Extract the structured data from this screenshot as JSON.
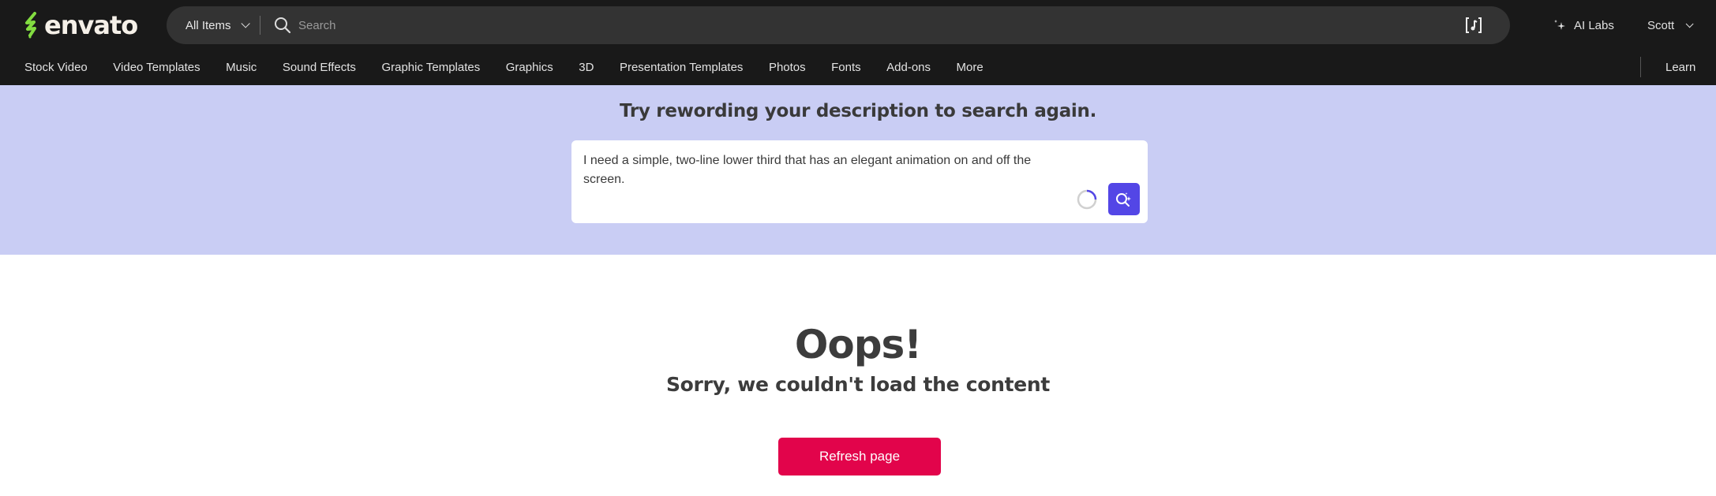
{
  "header": {
    "logo_text": "envato",
    "brand_color": "#82dc40",
    "category_select": "All Items",
    "search_placeholder": "Search",
    "ai_labs_label": "AI Labs",
    "user_name": "Scott",
    "icons": {
      "search": "search-icon",
      "audio_search": "music-note-scan-icon",
      "ai_labs": "sparkle-icon"
    }
  },
  "nav": {
    "items": [
      {
        "label": "Stock Video"
      },
      {
        "label": "Video Templates"
      },
      {
        "label": "Music"
      },
      {
        "label": "Sound Effects"
      },
      {
        "label": "Graphic Templates"
      },
      {
        "label": "Graphics"
      },
      {
        "label": "3D"
      },
      {
        "label": "Presentation Templates"
      },
      {
        "label": "Photos"
      },
      {
        "label": "Fonts"
      },
      {
        "label": "Add-ons"
      },
      {
        "label": "More"
      }
    ],
    "learn_label": "Learn"
  },
  "hero": {
    "title": "Try rewording your description to search again.",
    "prompt_value": "I need a simple, two-line lower third that has an elegant animation on and off the screen.",
    "accent_color": "#5346e6",
    "background_color": "#c9cdf4"
  },
  "error": {
    "heading": "Oops!",
    "message": "Sorry, we couldn't load the content",
    "refresh_label": "Refresh page",
    "button_color": "#e2044b"
  }
}
